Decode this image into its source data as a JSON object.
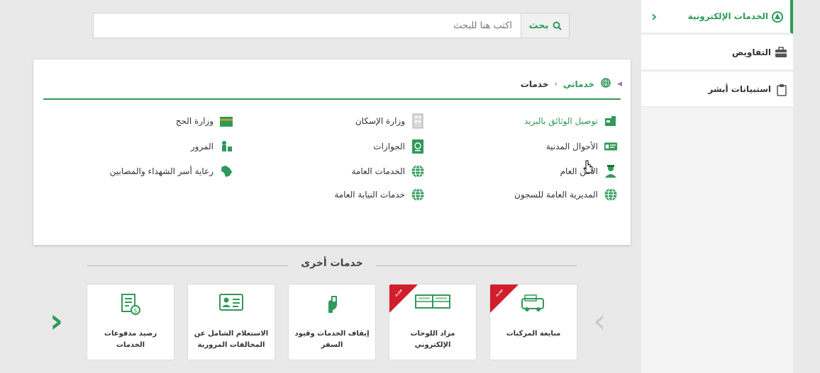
{
  "sidebar": {
    "items": [
      {
        "label": "الخدمات الإلكترونية",
        "icon": "eservices-icon",
        "active": true
      },
      {
        "label": "التفاويض",
        "icon": "briefcase-icon"
      },
      {
        "label": "استبيانات أبشر",
        "icon": "clipboard-icon"
      }
    ]
  },
  "search": {
    "button_label": "بحث",
    "placeholder": "اكتب هنا للبحث",
    "value": ""
  },
  "breadcrumb": {
    "home": "خدماتي",
    "current": "خدمات"
  },
  "services": [
    {
      "label": "توصيل الوثائق بالبريد",
      "icon": "mail-delivery-icon"
    },
    {
      "label": "وزارة الإسكان",
      "icon": "building-icon"
    },
    {
      "label": "وزارة الحج",
      "icon": "kaaba-icon"
    },
    {
      "label": "الأحوال المدنية",
      "icon": "id-card-icon"
    },
    {
      "label": "الجوازات",
      "icon": "passport-icon"
    },
    {
      "label": "المرور",
      "icon": "traffic-icon"
    },
    {
      "label": "الأمن العام",
      "icon": "officer-icon"
    },
    {
      "label": "الخدمات العامة",
      "icon": "globe-icon"
    },
    {
      "label": "رعاية أسر الشهداء والمصابين",
      "icon": "saudi-map-icon"
    },
    {
      "label": "المديرية العامة للسجون",
      "icon": "globe-icon"
    },
    {
      "label": "خدمات النيابة العامة",
      "icon": "globe-icon"
    }
  ],
  "other_services": {
    "title": "خدمات أخرى",
    "cards": [
      {
        "label": "مبايعة المركبات",
        "icon": "vehicles-icon",
        "badge": "جديد"
      },
      {
        "label": "مزاد اللوحات الإلكتروني",
        "icon": "plates-icon",
        "badge": "جديد"
      },
      {
        "label": "إيقاف الخدمات وقيود السفر",
        "icon": "stop-services-icon"
      },
      {
        "label": "الاستعلام الشامل عن المخالفات المرورية",
        "icon": "id-card-icon"
      },
      {
        "label": "رصيد مدفوعات الخدمات",
        "icon": "payment-receipt-icon"
      }
    ]
  },
  "colors": {
    "accent": "#2f9a58",
    "ribbon": "#d21e2b",
    "arrow_disabled": "#c9c9c9"
  }
}
